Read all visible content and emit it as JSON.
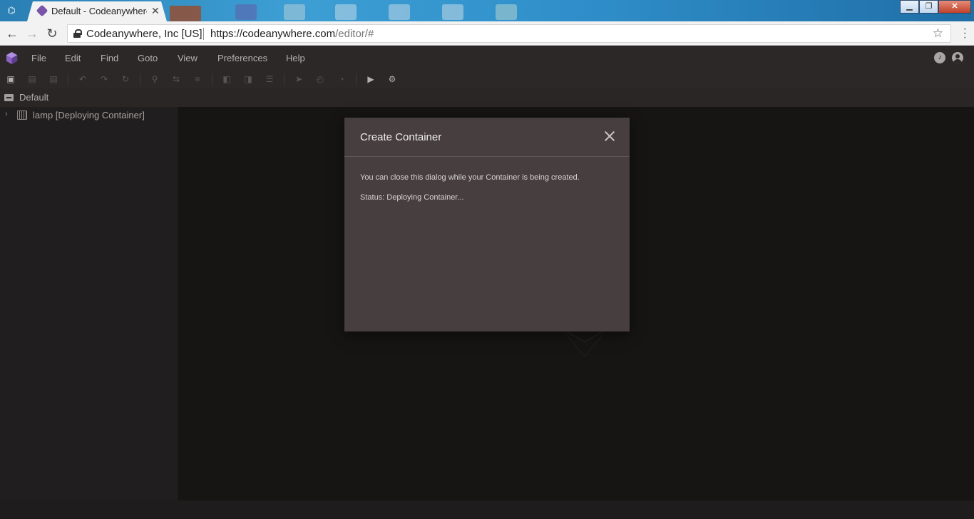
{
  "browser": {
    "tab_title": "Default - Codeanywhere",
    "tab_close": "✕",
    "org_name": "Codeanywhere, Inc [US]",
    "url_main": "https://codeanywhere.com",
    "url_path": "/editor/#",
    "window_buttons": {
      "minimize": "▁",
      "maximize": "❐",
      "close": "✕"
    }
  },
  "menubar": {
    "items": [
      "File",
      "Edit",
      "Find",
      "Goto",
      "View",
      "Preferences",
      "Help"
    ]
  },
  "sidebar": {
    "header": "Default",
    "tree": [
      {
        "label": "lamp [Deploying Container]",
        "expanded": false
      }
    ]
  },
  "dialog": {
    "title": "Create Container",
    "message": "You can close this dialog while your Container is being created.",
    "status": "Status: Deploying Container..."
  },
  "colors": {
    "brand": "#7a54a8",
    "dialog_bg": "#463e3f",
    "app_bg": "#161514"
  }
}
